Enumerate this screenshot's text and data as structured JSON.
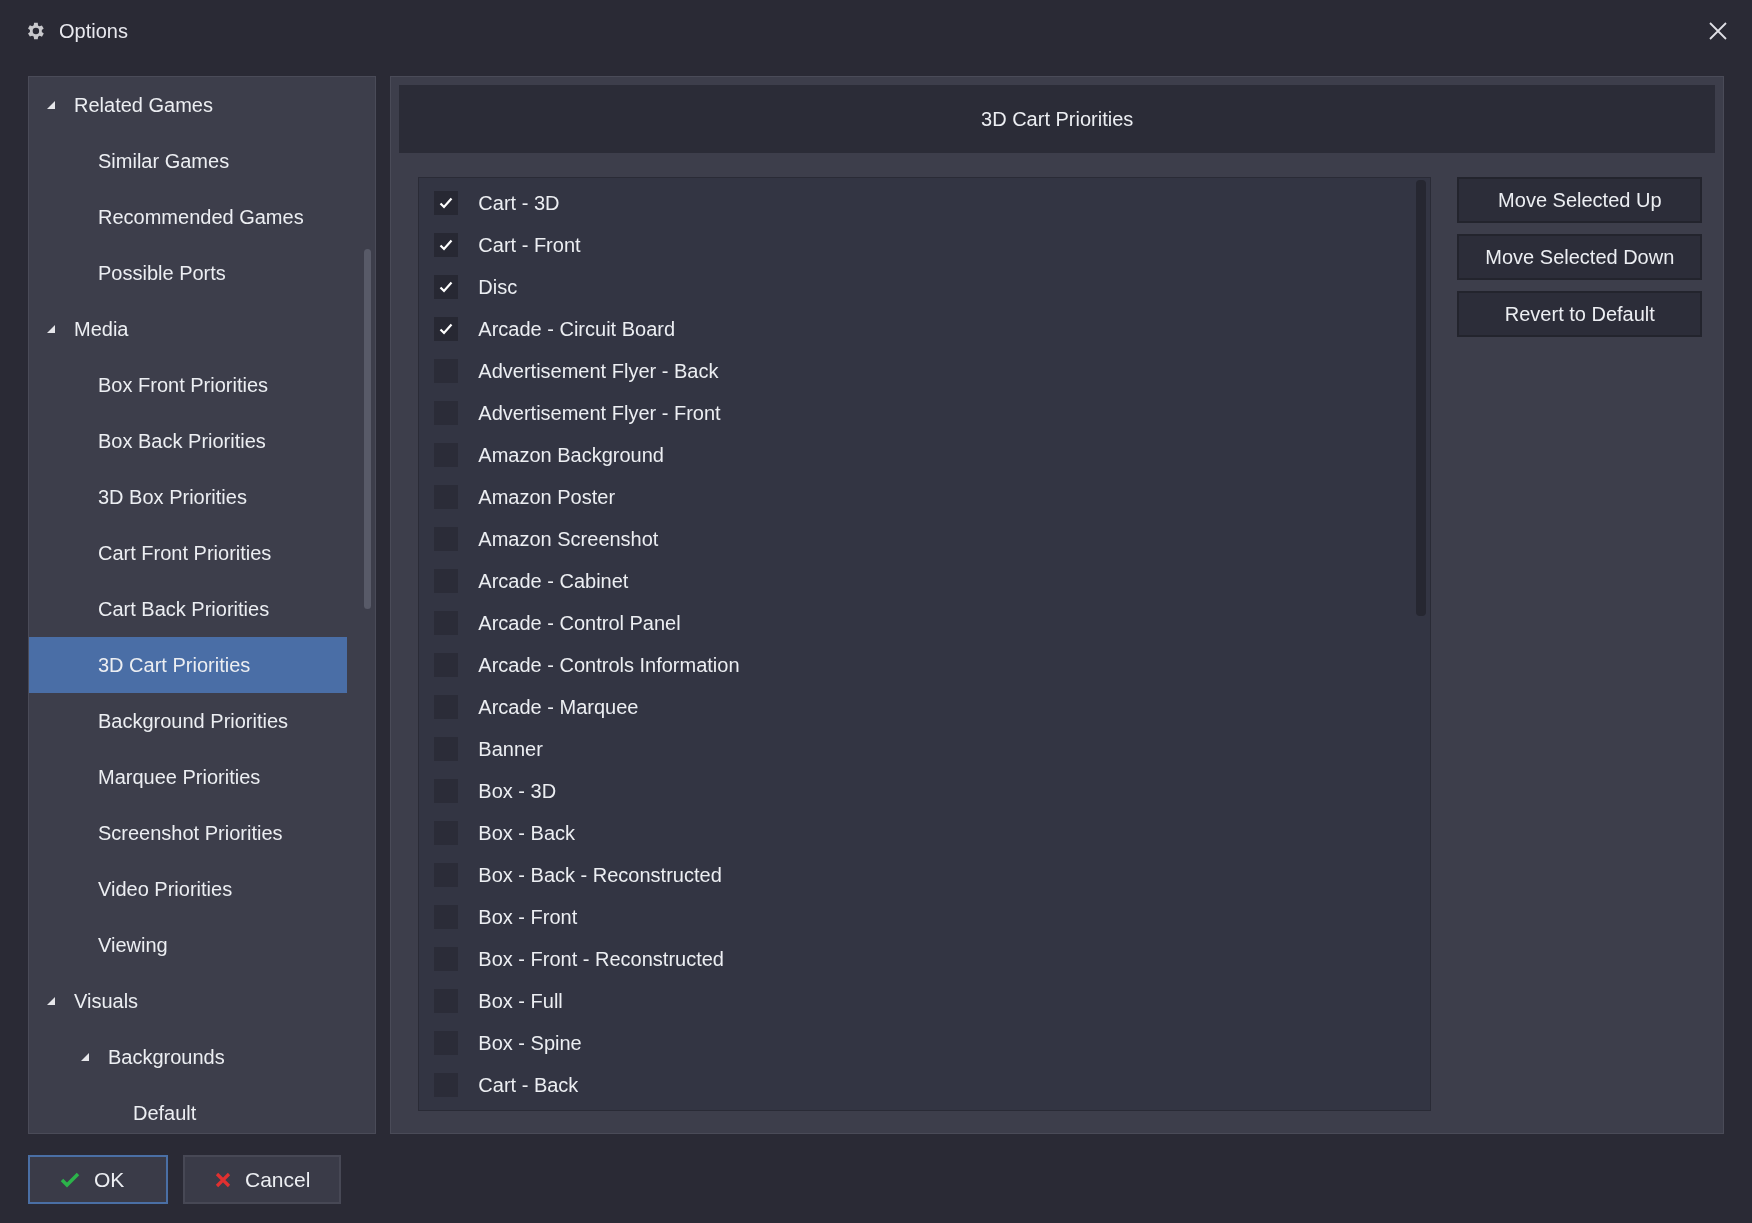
{
  "window": {
    "title": "Options"
  },
  "sidebar": {
    "items": [
      {
        "label": "Related Games",
        "expanded": true,
        "selected": false,
        "children": [
          {
            "label": "Similar Games",
            "selected": false
          },
          {
            "label": "Recommended Games",
            "selected": false
          },
          {
            "label": "Possible Ports",
            "selected": false
          }
        ]
      },
      {
        "label": "Media",
        "expanded": true,
        "selected": false,
        "children": [
          {
            "label": "Box Front Priorities",
            "selected": false
          },
          {
            "label": "Box Back Priorities",
            "selected": false
          },
          {
            "label": "3D Box Priorities",
            "selected": false
          },
          {
            "label": "Cart Front Priorities",
            "selected": false
          },
          {
            "label": "Cart Back Priorities",
            "selected": false
          },
          {
            "label": "3D Cart Priorities",
            "selected": true
          },
          {
            "label": "Background Priorities",
            "selected": false
          },
          {
            "label": "Marquee Priorities",
            "selected": false
          },
          {
            "label": "Screenshot Priorities",
            "selected": false
          },
          {
            "label": "Video Priorities",
            "selected": false
          },
          {
            "label": "Viewing",
            "selected": false
          }
        ]
      },
      {
        "label": "Visuals",
        "expanded": true,
        "selected": false,
        "children": [
          {
            "label": "Backgrounds",
            "expanded": true,
            "selected": false,
            "children": [
              {
                "label": "Default",
                "selected": false
              }
            ]
          }
        ]
      }
    ]
  },
  "panel": {
    "title": "3D Cart Priorities",
    "items": [
      {
        "label": "Cart - 3D",
        "checked": true
      },
      {
        "label": "Cart - Front",
        "checked": true
      },
      {
        "label": "Disc",
        "checked": true
      },
      {
        "label": "Arcade - Circuit Board",
        "checked": true
      },
      {
        "label": "Advertisement Flyer - Back",
        "checked": false
      },
      {
        "label": "Advertisement Flyer - Front",
        "checked": false
      },
      {
        "label": "Amazon Background",
        "checked": false
      },
      {
        "label": "Amazon Poster",
        "checked": false
      },
      {
        "label": "Amazon Screenshot",
        "checked": false
      },
      {
        "label": "Arcade - Cabinet",
        "checked": false
      },
      {
        "label": "Arcade - Control Panel",
        "checked": false
      },
      {
        "label": "Arcade - Controls Information",
        "checked": false
      },
      {
        "label": "Arcade - Marquee",
        "checked": false
      },
      {
        "label": "Banner",
        "checked": false
      },
      {
        "label": "Box - 3D",
        "checked": false
      },
      {
        "label": "Box - Back",
        "checked": false
      },
      {
        "label": "Box - Back - Reconstructed",
        "checked": false
      },
      {
        "label": "Box - Front",
        "checked": false
      },
      {
        "label": "Box - Front - Reconstructed",
        "checked": false
      },
      {
        "label": "Box - Full",
        "checked": false
      },
      {
        "label": "Box - Spine",
        "checked": false
      },
      {
        "label": "Cart - Back",
        "checked": false
      }
    ],
    "buttons": [
      "Move Selected Up",
      "Move Selected Down",
      "Revert to Default"
    ]
  },
  "footer": {
    "buttons": [
      {
        "label": "OK",
        "kind": "ok"
      },
      {
        "label": "Cancel",
        "kind": "cancel"
      }
    ]
  }
}
